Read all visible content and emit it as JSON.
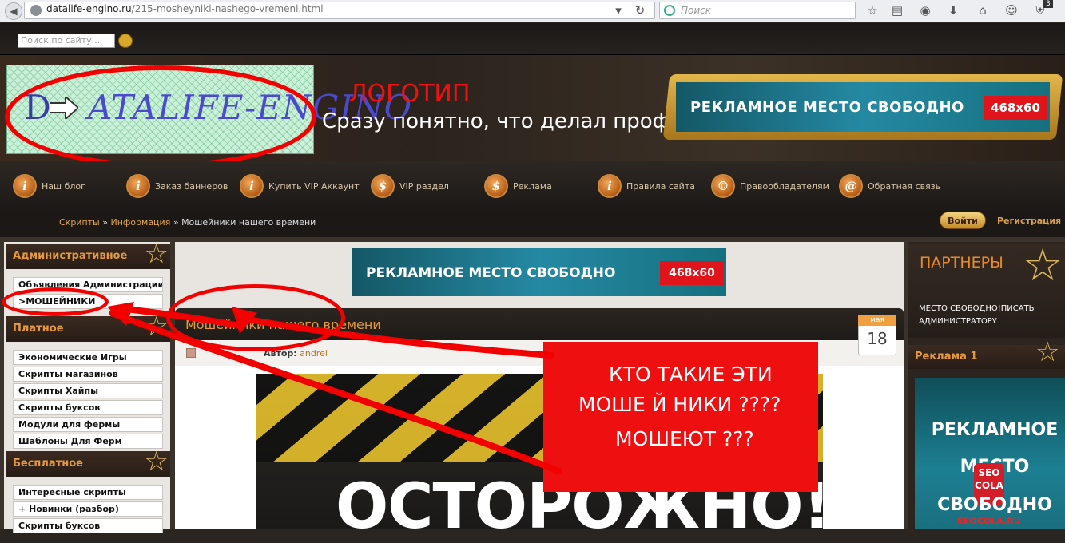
{
  "browser": {
    "url_host": "datalife-engino.ru",
    "url_path": "/215-mosheyniki-nashego-vremeni.html",
    "search_placeholder": "Поиск",
    "badge": "3"
  },
  "site": {
    "search_placeholder": "Поиск по сайту...",
    "logo_text": "ATALIFE-ENGINO",
    "logo_letter": "D",
    "logo_annotation": "ЛОГОТИП",
    "logo_caption": "Сразу понятно, что делал проффи",
    "header_banner": {
      "text": "РЕКЛАМНОЕ  МЕСТО СВОБОДНО",
      "size": "468x60"
    }
  },
  "nav": [
    {
      "icon": "info-icon",
      "glyph": "i",
      "label": "Наш блог"
    },
    {
      "icon": "info-icon",
      "glyph": "i",
      "label": "Заказ баннеров"
    },
    {
      "icon": "info-icon",
      "glyph": "i",
      "label": "Купить VIP Аккаунт"
    },
    {
      "icon": "dollar-icon",
      "glyph": "$",
      "label": "VIP раздел"
    },
    {
      "icon": "dollar-icon",
      "glyph": "$",
      "label": "Реклама"
    },
    {
      "icon": "info-icon",
      "glyph": "i",
      "label": "Правила сайта"
    },
    {
      "icon": "copyright-icon",
      "glyph": "©",
      "label": "Правообладателям"
    },
    {
      "icon": "at-icon",
      "glyph": "@",
      "label": "Обратная связь"
    }
  ],
  "breadcrumb": {
    "items": [
      "Скрипты",
      "Информация"
    ],
    "separator": "»",
    "current": "Мошейники нашего времени"
  },
  "auth": {
    "login": "Войти",
    "register": "Регистрация"
  },
  "sidebar_left": {
    "sections": [
      {
        "title": "Административное",
        "items": [
          "Объявления Администрации",
          ">МОШЕЙНИКИ"
        ]
      },
      {
        "title": "Платное",
        "items": [
          "Экономические Игры",
          "Скрипты магазинов",
          "Скрипты Хайпы",
          "Скрипты буксов",
          "Модули для фермы",
          "Шаблоны Для Ферм"
        ]
      },
      {
        "title": "Бесплатное",
        "items": [
          "Интересные скрипты",
          "+ Новинки (разбор)",
          "Скрипты буксов"
        ]
      }
    ]
  },
  "center": {
    "banner": {
      "text": "РЕКЛАМНОЕ  МЕСТО СВОБОДНО",
      "size": "468x60"
    },
    "article": {
      "title": "Мошейники нашего времени",
      "author_label": "Автор:",
      "author": "andrei",
      "date_month": "мая",
      "date_day": "18",
      "image_text": "ОСТОРОЖНО!"
    },
    "annotation_box": {
      "line1": "КТО ТАКИЕ ЭТИ",
      "line2": "МОШЕ  Й  НИКИ ????",
      "line3": "МОШЕЮТ ???"
    }
  },
  "sidebar_right": {
    "partners_title": "ПАРТНЕРЫ",
    "partners_text": "МЕСТО СВОБОДНО!ПИСАТЬ АДМИНИСТРАТОРУ",
    "ad_title": "Реклама 1",
    "ad_lines": [
      "РЕКЛАМНОЕ",
      "МЕСТО",
      "СВОБОДНО"
    ],
    "ad_logo": "SEO COLA",
    "ad_footer": "SEOCOLA.RU"
  },
  "colors": {
    "annotation_red": "#f20000",
    "accent_orange": "#e89a3a",
    "banner_teal": "#2589a3"
  }
}
